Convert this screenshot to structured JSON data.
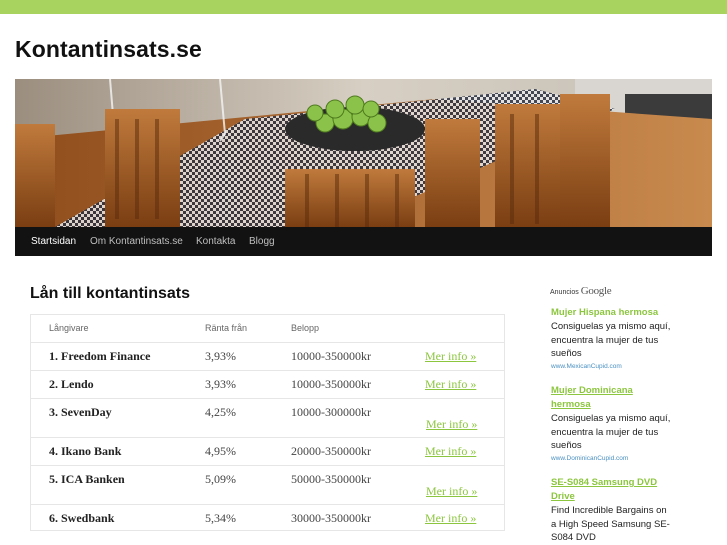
{
  "site": {
    "title": "Kontantinsats.se"
  },
  "nav": {
    "items": [
      {
        "label": "Startsidan",
        "active": true
      },
      {
        "label": "Om Kontantinsats.se",
        "active": false
      },
      {
        "label": "Kontakta",
        "active": false
      },
      {
        "label": "Blogg",
        "active": false
      }
    ]
  },
  "main": {
    "heading": "Lån till kontantinsats",
    "table": {
      "headers": [
        "Långivare",
        "Ränta från",
        "Belopp"
      ],
      "rows": [
        {
          "name": "1. Freedom Finance",
          "rate": "3,93%",
          "amount": "10000-350000kr",
          "link": "Mer info »"
        },
        {
          "name": "2. Lendo",
          "rate": "3,93%",
          "amount": "10000-350000kr",
          "link": "Mer info »"
        },
        {
          "name": "3. SevenDay",
          "rate": "4,25%",
          "amount": "10000-300000kr",
          "link": "Mer info »"
        },
        {
          "name": "4. Ikano Bank",
          "rate": "4,95%",
          "amount": "20000-350000kr",
          "link": "Mer info »"
        },
        {
          "name": "5. ICA Banken",
          "rate": "5,09%",
          "amount": "50000-350000kr",
          "link": "Mer info »"
        },
        {
          "name": "6. Swedbank",
          "rate": "5,34%",
          "amount": "30000-350000kr",
          "link": "Mer info »"
        }
      ]
    }
  },
  "ads": {
    "label": "Anuncios",
    "brand": "Google",
    "items": [
      {
        "title": "Mujer Hispana hermosa",
        "text": "Consiguelas ya mismo aquí, encuentra la mujer de tus sueños",
        "url": "www.MexicanCupid.com"
      },
      {
        "title": "Mujer Dominicana hermosa",
        "text": "Consiguelas ya mismo aquí, encuentra la mujer de tus sueños",
        "url": "www.DominicanCupid.com"
      },
      {
        "title": "SE-S084 Samsung DVD Drive",
        "text": "Find Incredible Bargains on a High Speed Samsung SE-S084 DVD",
        "url": ""
      }
    ]
  },
  "colors": {
    "accent": "#8cc63f",
    "topbar": "#a8d35e",
    "nav_bg": "#121212"
  }
}
